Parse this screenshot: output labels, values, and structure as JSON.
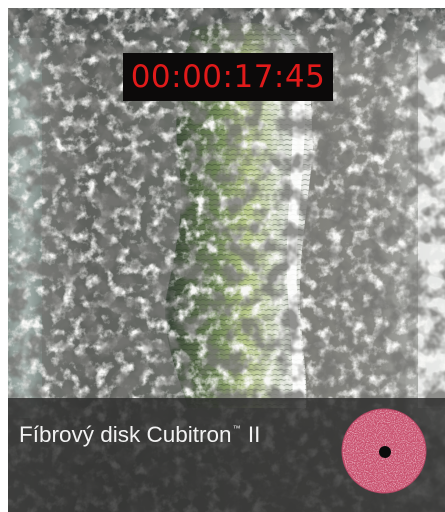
{
  "video": {
    "timecode": "00:00:17:45",
    "caption": {
      "text": "Fíbrový disk Cubitron",
      "trademark": "™",
      "suffix": "II"
    }
  },
  "colors": {
    "timecode_text": "#e11a1a",
    "timecode_background": "#0c0a0a",
    "caption_text": "#f2f2f2",
    "disc": "#c8506e"
  },
  "icons": {
    "product": "fibre-disc-icon"
  }
}
